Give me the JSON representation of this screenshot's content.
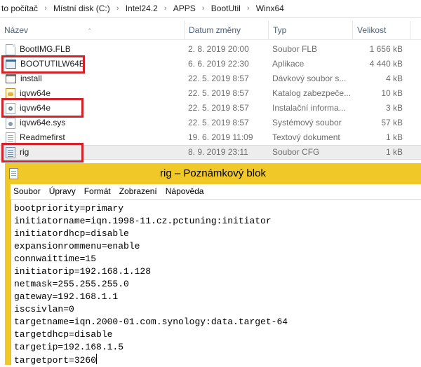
{
  "explorer": {
    "breadcrumb": [
      "to počítač",
      "Místní disk (C:)",
      "Intel24.2",
      "APPS",
      "BootUtil",
      "Winx64"
    ],
    "columns": {
      "name": "Název",
      "date": "Datum změny",
      "type": "Typ",
      "size": "Velikost"
    },
    "files": [
      {
        "name": "BootIMG.FLB",
        "date": "2. 8. 2019 20:00",
        "type": "Soubor FLB",
        "size": "1 656 kB",
        "icon": "document-icon",
        "highlighted": false,
        "selected": false
      },
      {
        "name": "BOOTUTILW64E",
        "date": "6. 6. 2019 22:30",
        "type": "Aplikace",
        "size": "4 440 kB",
        "icon": "application-icon",
        "highlighted": true,
        "selected": false
      },
      {
        "name": "install",
        "date": "22. 5. 2019 8:57",
        "type": "Dávkový soubor s...",
        "size": "4 kB",
        "icon": "batch-file-icon",
        "highlighted": false,
        "selected": false
      },
      {
        "name": "iqvw64e",
        "date": "22. 5. 2019 8:57",
        "type": "Katalog zabezpeče...",
        "size": "10 kB",
        "icon": "security-catalog-icon",
        "highlighted": false,
        "selected": false
      },
      {
        "name": "iqvw64e",
        "date": "22. 5. 2019 8:57",
        "type": "Instalační informa...",
        "size": "3 kB",
        "icon": "setup-information-icon",
        "highlighted": true,
        "selected": false
      },
      {
        "name": "iqvw64e.sys",
        "date": "22. 5. 2019 8:57",
        "type": "Systémový soubor",
        "size": "57 kB",
        "icon": "system-file-icon",
        "highlighted": false,
        "selected": false
      },
      {
        "name": "Readmefirst",
        "date": "19. 6. 2019 11:09",
        "type": "Textový dokument",
        "size": "1 kB",
        "icon": "text-document-icon",
        "highlighted": false,
        "selected": false
      },
      {
        "name": "rig",
        "date": "8. 9. 2019 23:11",
        "type": "Soubor CFG",
        "size": "1 kB",
        "icon": "config-file-icon",
        "highlighted": true,
        "selected": true
      }
    ],
    "highlight_color": "#d2232a"
  },
  "notepad": {
    "title": "rig – Poznámkový blok",
    "menu": [
      "Soubor",
      "Úpravy",
      "Formát",
      "Zobrazení",
      "Nápověda"
    ],
    "lines": [
      "bootpriority=primary",
      "initiatorname=iqn.1998-11.cz.pctuning:initiator",
      "initiatordhcp=disable",
      "expansionrommenu=enable",
      "connwaittime=15",
      "initiatorip=192.168.1.128",
      "netmask=255.255.255.0",
      "gateway=192.168.1.1",
      "iscsivlan=0",
      "targetname=iqn.2000-01.com.synology:data.target-64",
      "targetdhcp=disable",
      "targetip=192.168.1.5",
      "targetport=3260"
    ],
    "title_bar_color": "#f0c929"
  }
}
